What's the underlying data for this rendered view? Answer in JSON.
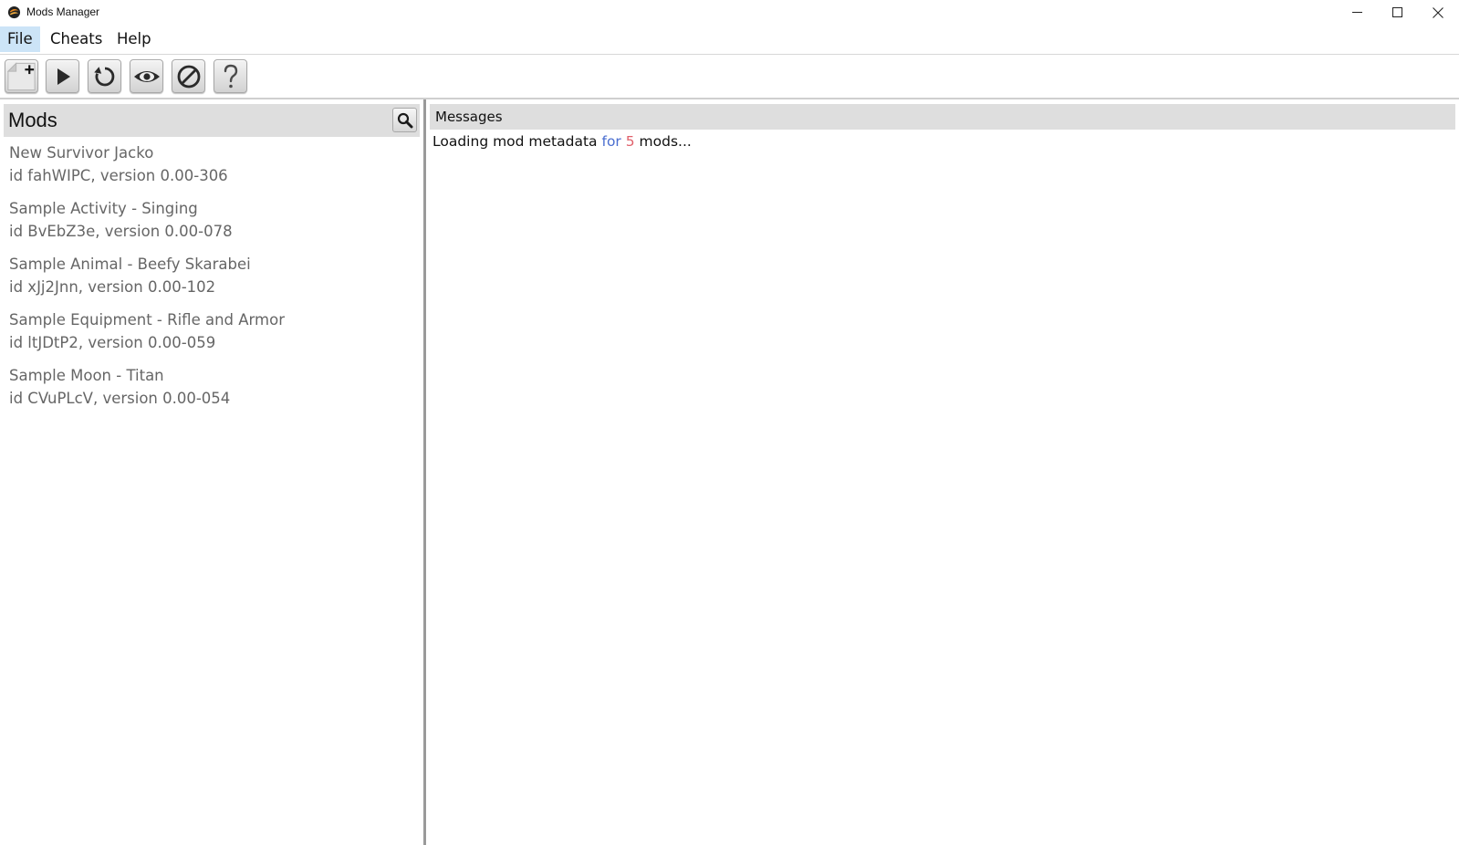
{
  "window": {
    "title": "Mods Manager"
  },
  "menu": {
    "items": [
      {
        "label": "File",
        "name": "menu-file"
      },
      {
        "label": "Cheats",
        "name": "menu-cheats"
      },
      {
        "label": "Help",
        "name": "menu-help"
      }
    ]
  },
  "toolbar": {
    "buttons": [
      {
        "name": "new-mod-button",
        "icon": "new-document-plus-icon"
      },
      {
        "name": "play-button",
        "icon": "play-icon"
      },
      {
        "name": "reload-button",
        "icon": "reload-icon"
      },
      {
        "name": "view-button",
        "icon": "eye-icon"
      },
      {
        "name": "disable-button",
        "icon": "prohibited-icon"
      },
      {
        "name": "help-button",
        "icon": "question-mark-icon"
      }
    ]
  },
  "mods_panel": {
    "title": "Mods",
    "search_icon": "magnifier-icon",
    "items": [
      {
        "name": "New Survivor Jacko",
        "details": "id fahWIPC, version 0.00-306"
      },
      {
        "name": "Sample Activity - Singing",
        "details": "id BvEbZ3e, version 0.00-078"
      },
      {
        "name": "Sample Animal - Beefy Skarabei",
        "details": "id xJj2Jnn, version 0.00-102"
      },
      {
        "name": "Sample Equipment - Rifle and Armor",
        "details": "id ltJDtP2, version 0.00-059"
      },
      {
        "name": "Sample Moon - Titan",
        "details": "id CVuPLcV, version 0.00-054"
      }
    ]
  },
  "messages_panel": {
    "title": "Messages",
    "lines": [
      {
        "prefix": "Loading mod metadata ",
        "keyword": "for",
        "space": " ",
        "count": "5",
        "suffix": " mods..."
      }
    ]
  },
  "colors": {
    "menu_highlight": "#cce4f7",
    "header_bg": "#dedede",
    "keyword": "#4a6ed0",
    "number": "#e0606a",
    "mod_text": "#666666"
  }
}
